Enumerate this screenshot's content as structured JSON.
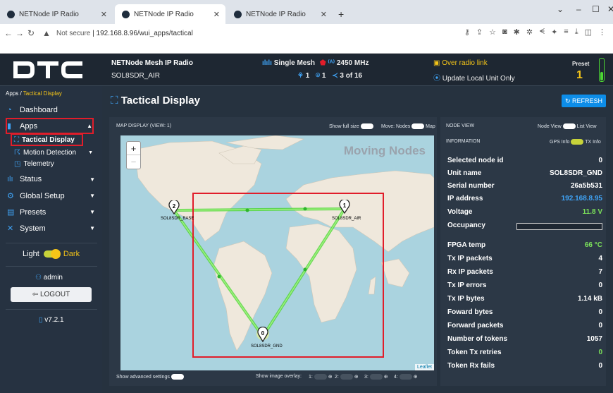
{
  "browser": {
    "tabs": [
      {
        "title": "NETNode IP Radio"
      },
      {
        "title": "NETNode IP Radio"
      },
      {
        "title": "NETNode IP Radio"
      }
    ],
    "security_label": "Not secure",
    "url": "192.168.8.96/wui_apps/tactical"
  },
  "header": {
    "logo": "DTC",
    "title": "NETNode Mesh IP Radio",
    "unit": "SOL8SDR_AIR",
    "mesh": "Single Mesh",
    "freq": "2450 MHz",
    "nodes_count": "1",
    "pins_count": "1",
    "share_count": "3 of 16",
    "over_radio": "Over radio link",
    "update_local": "Update Local Unit Only",
    "preset_label": "Preset",
    "preset_value": "1"
  },
  "sidebar": {
    "breadcrumb_app": "Apps",
    "breadcrumb_page": "Tactical Display",
    "items": [
      {
        "label": "Dashboard"
      },
      {
        "label": "Apps"
      },
      {
        "label": "Tactical Display"
      },
      {
        "label": "Motion Detection"
      },
      {
        "label": "Telemetry"
      },
      {
        "label": "Status"
      },
      {
        "label": "Global Setup"
      },
      {
        "label": "Presets"
      },
      {
        "label": "System"
      }
    ],
    "theme_light": "Light",
    "theme_dark": "Dark",
    "user": "admin",
    "logout": "LOGOUT",
    "version": "v7.2.1"
  },
  "main": {
    "title": "Tactical Display",
    "refresh": "REFRESH",
    "map_header": "MAP DISPLAY (VIEW: 1)",
    "show_full_size": "Show full size",
    "move_label": "Move: Nodes",
    "move_map": "Map",
    "overlay_text": "Moving Nodes",
    "leaflet": "Leaflet",
    "nodes": [
      {
        "id": "2",
        "label": "SOL8SDR_BASE"
      },
      {
        "id": "1",
        "label": "SOL8SDR_AIR"
      },
      {
        "id": "0",
        "label": "SOL8SDR_GND"
      }
    ],
    "show_advanced": "Show advanced settings",
    "show_image_overlay": "Show image overlay:",
    "overlay_slots": [
      "1:",
      "2:",
      "3:",
      "4:"
    ]
  },
  "node_view": {
    "title": "NODE VIEW",
    "node_view_toggle": "Node View",
    "list_view": "List View",
    "information": "INFORMATION",
    "gps_info": "GPS Info",
    "tx_info": "TX Info",
    "rows": [
      {
        "label": "Selected node id",
        "value": "0"
      },
      {
        "label": "Unit name",
        "value": "SOL8SDR_GND"
      },
      {
        "label": "Serial number",
        "value": "26a5b531"
      },
      {
        "label": "IP address",
        "value": "192.168.8.95"
      },
      {
        "label": "Voltage",
        "value": "11.8 V"
      },
      {
        "label": "Occupancy",
        "value": ""
      },
      {
        "label": "FPGA temp",
        "value": "66 °C"
      },
      {
        "label": "Tx IP packets",
        "value": "4"
      },
      {
        "label": "Rx IP packets",
        "value": "7"
      },
      {
        "label": "Tx IP errors",
        "value": "0"
      },
      {
        "label": "Tx IP bytes",
        "value": "1.14 kB"
      },
      {
        "label": "Foward bytes",
        "value": "0"
      },
      {
        "label": "Forward packets",
        "value": "0"
      },
      {
        "label": "Number of tokens",
        "value": "1057"
      },
      {
        "label": "Token Tx retries",
        "value": "0"
      },
      {
        "label": "Token Rx fails",
        "value": "0"
      }
    ]
  },
  "colors": {
    "accent": "#f5c518",
    "blue": "#0d8de8",
    "green": "#4cd633",
    "red": "#e11d2a"
  }
}
